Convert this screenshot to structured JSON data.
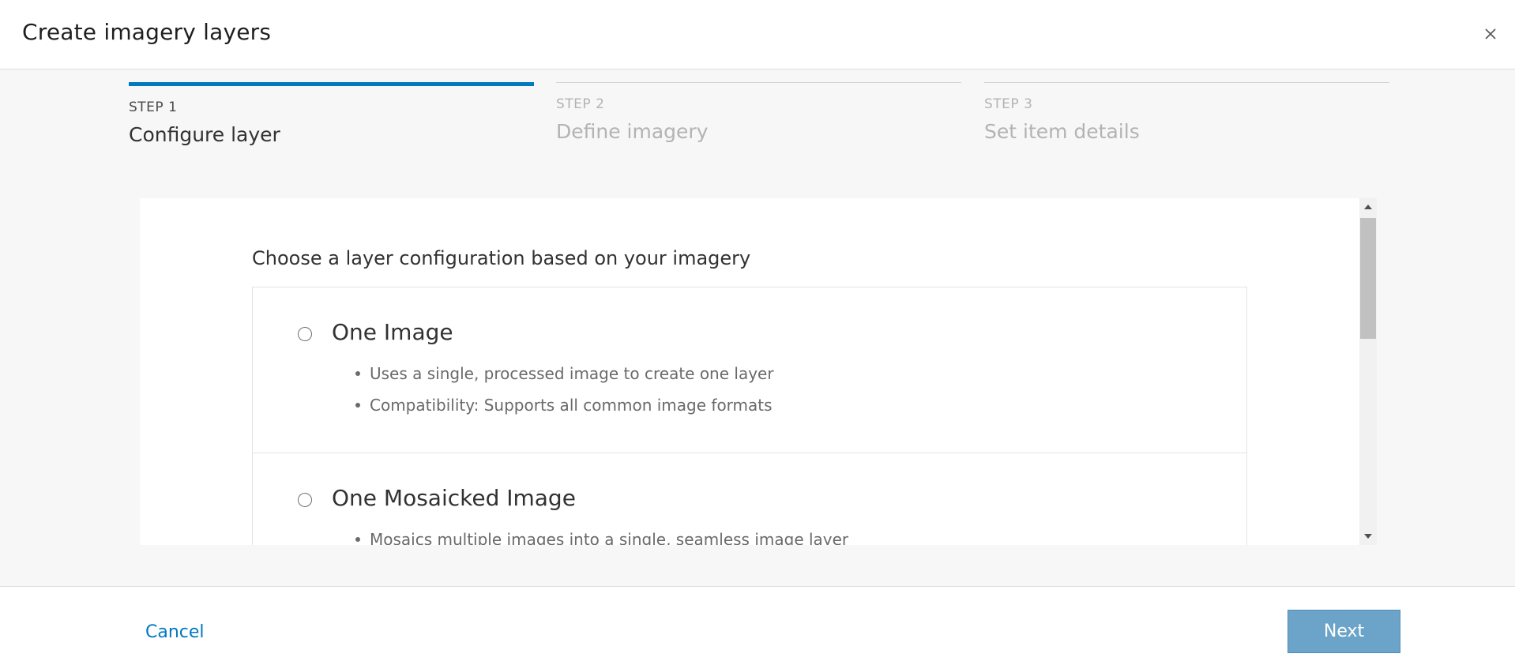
{
  "dialog": {
    "title": "Create imagery layers"
  },
  "steps": [
    {
      "number": "STEP 1",
      "name": "Configure layer",
      "active": true
    },
    {
      "number": "STEP 2",
      "name": "Define imagery",
      "active": false
    },
    {
      "number": "STEP 3",
      "name": "Set item details",
      "active": false
    }
  ],
  "panel": {
    "prompt": "Choose a layer configuration based on your imagery",
    "options": [
      {
        "title": "One Image",
        "selected": false,
        "bullets": [
          "Uses a single, processed image to create one layer",
          "Compatibility: Supports all common image formats"
        ]
      },
      {
        "title": "One Mosaicked Image",
        "selected": false,
        "bullets": [
          "Mosaics multiple images into a single, seamless image layer"
        ]
      }
    ]
  },
  "footer": {
    "cancel_label": "Cancel",
    "next_label": "Next"
  },
  "icons": {
    "close": "close-icon",
    "scroll_up": "chevron-up-icon",
    "scroll_down": "chevron-down-icon"
  },
  "colors": {
    "accent": "#0079c1",
    "next_button": "#6ba4c8",
    "panel_background": "#f7f7f7"
  }
}
